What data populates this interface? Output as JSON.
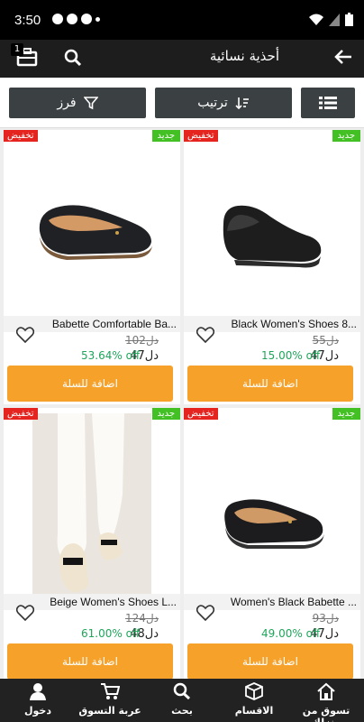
{
  "status": {
    "time": "3:50"
  },
  "header": {
    "title": "أحذية نسائية",
    "cart_count": "1"
  },
  "toolbar": {
    "filter_label": "فرز",
    "sort_label": "ترتيب"
  },
  "products": [
    {
      "badge_sale": "تخفيض",
      "badge_new": "جديد",
      "name": "Babette Comfortable Ba...",
      "old_price": "102دل",
      "new_price": "47دل",
      "discount": "53.64% off",
      "add_label": "اضافة للسلة"
    },
    {
      "badge_sale": "تخفيض",
      "badge_new": "جديد",
      "name": "Black Women's Shoes 8...",
      "old_price": "55دل",
      "new_price": "47دل",
      "discount": "15.00% off",
      "add_label": "اضافة للسلة"
    },
    {
      "badge_sale": "تخفيض",
      "badge_new": "جديد",
      "name": "Beige Women's Shoes L...",
      "old_price": "124دل",
      "new_price": "48دل",
      "discount": "61.00% off",
      "add_label": "اضافة للسلة"
    },
    {
      "badge_sale": "تخفيض",
      "badge_new": "جديد",
      "name": "Women's Black Babette ...",
      "old_price": "93دل",
      "new_price": "47دل",
      "discount": "49.00% off",
      "add_label": "اضافة للسلة"
    }
  ],
  "bottom_nav": [
    {
      "label": "دخول",
      "icon": "user-icon"
    },
    {
      "label": "عربة التسوق",
      "icon": "cart-icon"
    },
    {
      "label": "بحث",
      "icon": "search-icon"
    },
    {
      "label": "الاقسام",
      "icon": "box-icon"
    },
    {
      "label": "تسوق من منزلك",
      "icon": "home-icon"
    }
  ]
}
